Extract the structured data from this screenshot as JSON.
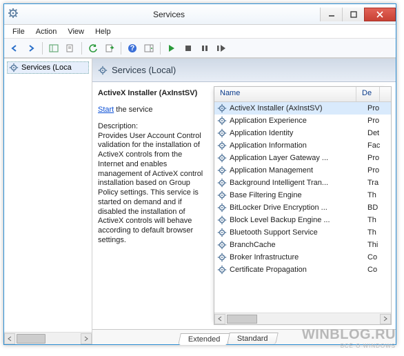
{
  "window": {
    "title": "Services"
  },
  "menu": {
    "file": "File",
    "action": "Action",
    "view": "View",
    "help": "Help"
  },
  "tree": {
    "root": "Services (Loca"
  },
  "header": {
    "label": "Services (Local)"
  },
  "detail": {
    "name": "ActiveX Installer (AxInstSV)",
    "startLink": "Start",
    "startSuffix": " the service",
    "descLabel": "Description:",
    "desc": "Provides User Account Control validation for the installation of ActiveX controls from the Internet and enables management of ActiveX control installation based on Group Policy settings. This service is started on demand and if disabled the installation of ActiveX controls will behave according to default browser settings."
  },
  "columns": {
    "name": "Name",
    "desc": "De"
  },
  "services": [
    {
      "name": "ActiveX Installer (AxInstSV)",
      "desc": "Pro",
      "selected": true
    },
    {
      "name": "Application Experience",
      "desc": "Pro"
    },
    {
      "name": "Application Identity",
      "desc": "Det"
    },
    {
      "name": "Application Information",
      "desc": "Fac"
    },
    {
      "name": "Application Layer Gateway ...",
      "desc": "Pro"
    },
    {
      "name": "Application Management",
      "desc": "Pro"
    },
    {
      "name": "Background Intelligent Tran...",
      "desc": "Tra"
    },
    {
      "name": "Base Filtering Engine",
      "desc": "Th"
    },
    {
      "name": "BitLocker Drive Encryption ...",
      "desc": "BD"
    },
    {
      "name": "Block Level Backup Engine ...",
      "desc": "Th"
    },
    {
      "name": "Bluetooth Support Service",
      "desc": "Th"
    },
    {
      "name": "BranchCache",
      "desc": "Thi"
    },
    {
      "name": "Broker Infrastructure",
      "desc": "Co"
    },
    {
      "name": "Certificate Propagation",
      "desc": "Co"
    }
  ],
  "tabs": {
    "extended": "Extended",
    "standard": "Standard"
  },
  "watermark": {
    "line1": "WINBLOG.RU",
    "line2": "ВСЁ О WINDOWS"
  }
}
